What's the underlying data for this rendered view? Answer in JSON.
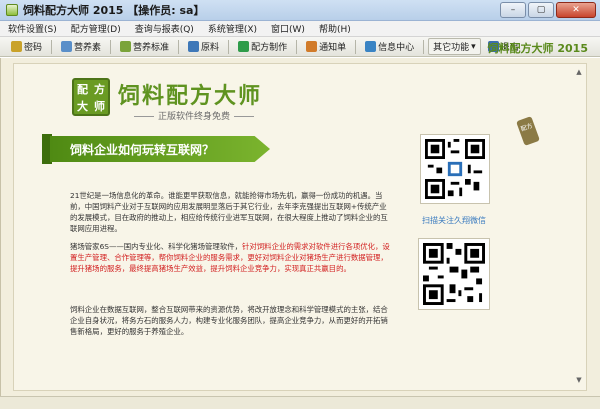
{
  "window": {
    "title": "饲料配方大师 2015 【操作员: sa】",
    "controls": [
      "–",
      "▢",
      "✕"
    ]
  },
  "menu": {
    "items": [
      "软件设置(S)",
      "配方管理(D)",
      "查询与报表(Q)",
      "系统管理(X)",
      "窗口(W)",
      "帮助(H)"
    ]
  },
  "toolbar": {
    "buttons": [
      {
        "label": "密码",
        "icon": "key-icon",
        "color": "#c9a22a"
      },
      {
        "label": "营养素",
        "icon": "nutrient-icon",
        "color": "#5a8fc9"
      },
      {
        "label": "营养标准",
        "icon": "standard-icon",
        "color": "#7aa33a"
      },
      {
        "label": "原料",
        "icon": "material-icon",
        "color": "#3e78b8"
      },
      {
        "label": "配方制作",
        "icon": "formula-icon",
        "color": "#2f9c4a"
      },
      {
        "label": "通知单",
        "icon": "notice-icon",
        "color": "#d17b2a"
      },
      {
        "label": "信息中心",
        "icon": "info-icon",
        "color": "#3a84c4"
      }
    ],
    "dropdown_label": "其它功能",
    "exit_label": "退出",
    "brand": "饲料配方大师 2015"
  },
  "content": {
    "logo_chars": [
      "配",
      "方",
      "大",
      "师"
    ],
    "brand_title": "饲料配方大师",
    "brand_sub": "正版软件终身免费",
    "banner": "饲料企业如何玩转互联网？",
    "paragraphs": {
      "p1": "21世纪是一场信息化的革命。谁能更早获取信息，就能抢得市场先机，赢得一份成功的机遇。当前，中国饲料产业对于互联网的应用发展明显落后于其它行业，去年李克强提出互联网+传统产业的发展模式，目在政府的推动上，相应给传统行业进军互联网，在很大程度上推动了饲料企业的互联网应用进程。",
      "p2_black": "猪场管家6S——国内专业化、科学化猪场管理软件，",
      "p2_red": "针对饲料企业的需求对软件进行各项优化，设置生产管理、合作管理等，帮你饲料企业的服务需求，更好对饲料企业对猪场生产进行数据管理，提升猪场的服务，最终提高猪场生产效益，提升饲料企业竞争力，实现真正共赢目的。",
      "p3": "饲料企业在数据互联网，整合互联网带来的资源优势，将改开放理念和科学管理模式的主张，结合企业自身状况，将务方石的服务人力，构建专业化服务团队，提高企业竞争力，从而更好的开拓销售新格局，更好的服务于养殖企业。"
    },
    "qr_caption": "扫描关注久翔微信",
    "tag_text": "配方"
  },
  "colors": {
    "brand_green": "#5f9320",
    "red_text": "#d21f1f"
  }
}
